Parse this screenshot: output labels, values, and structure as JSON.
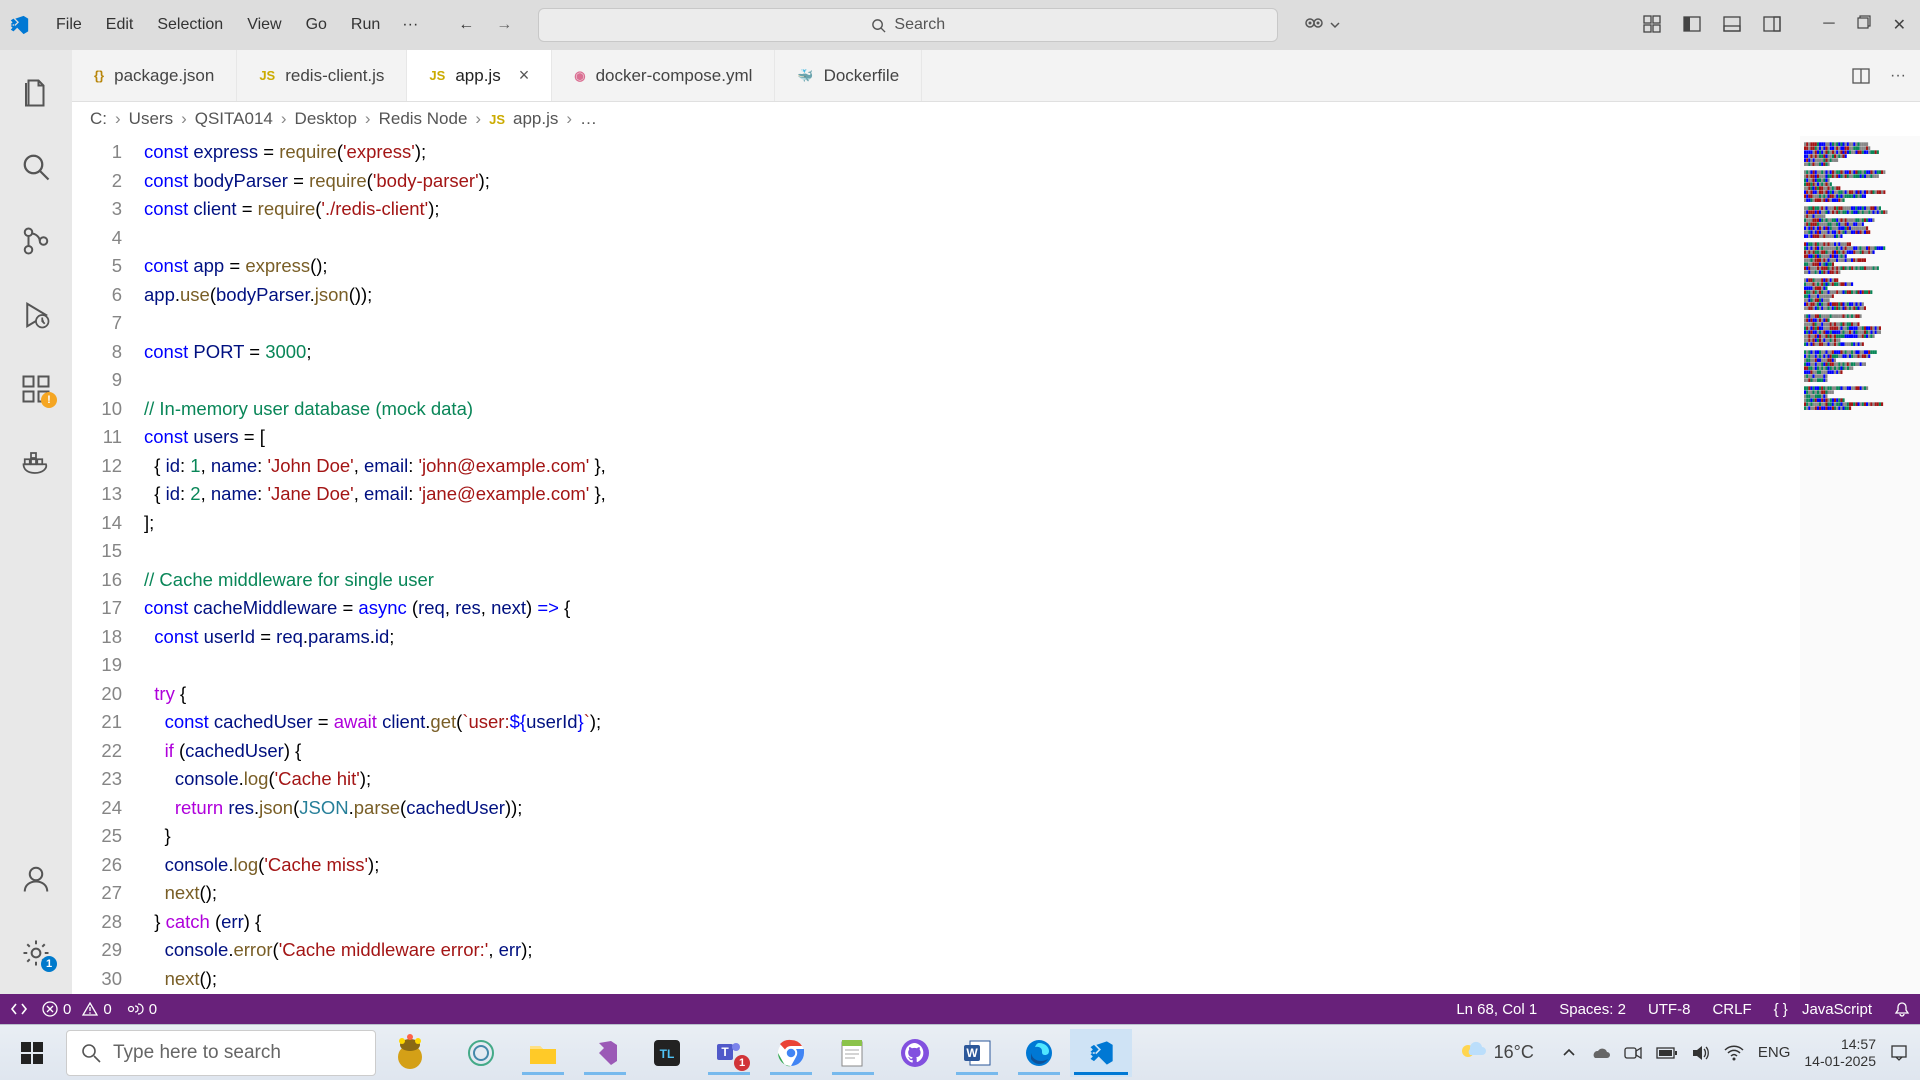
{
  "menu": {
    "file": "File",
    "edit": "Edit",
    "selection": "Selection",
    "view": "View",
    "go": "Go",
    "run": "Run"
  },
  "search_placeholder": "Search",
  "tabs": [
    {
      "icon": "{}",
      "icon_color": "#b8860b",
      "name": "package.json"
    },
    {
      "icon": "JS",
      "icon_color": "#cbab00",
      "name": "redis-client.js"
    },
    {
      "icon": "JS",
      "icon_color": "#cbab00",
      "name": "app.js",
      "active": true
    },
    {
      "icon": "◉",
      "icon_color": "#db7093",
      "name": "docker-compose.yml"
    },
    {
      "icon": "🐳",
      "icon_color": "#2496ed",
      "name": "Dockerfile"
    }
  ],
  "breadcrumb": [
    "C:",
    "Users",
    "QSITA014",
    "Desktop",
    "Redis Node",
    "app.js",
    "…"
  ],
  "code_lines": [
    [
      {
        "t": "const ",
        "c": "kw-blue"
      },
      {
        "t": "express",
        "c": "kw-var"
      },
      {
        "t": " = "
      },
      {
        "t": "require",
        "c": "kw-func"
      },
      {
        "t": "("
      },
      {
        "t": "'express'",
        "c": "kw-red"
      },
      {
        "t": ");"
      }
    ],
    [
      {
        "t": "const ",
        "c": "kw-blue"
      },
      {
        "t": "bodyParser",
        "c": "kw-var"
      },
      {
        "t": " = "
      },
      {
        "t": "require",
        "c": "kw-func"
      },
      {
        "t": "("
      },
      {
        "t": "'body-parser'",
        "c": "kw-red"
      },
      {
        "t": ");"
      }
    ],
    [
      {
        "t": "const ",
        "c": "kw-blue"
      },
      {
        "t": "client",
        "c": "kw-var"
      },
      {
        "t": " = "
      },
      {
        "t": "require",
        "c": "kw-func"
      },
      {
        "t": "("
      },
      {
        "t": "'./redis-client'",
        "c": "kw-red"
      },
      {
        "t": ");"
      }
    ],
    [
      {
        "t": ""
      }
    ],
    [
      {
        "t": "const ",
        "c": "kw-blue"
      },
      {
        "t": "app",
        "c": "kw-var"
      },
      {
        "t": " = "
      },
      {
        "t": "express",
        "c": "kw-func"
      },
      {
        "t": "();"
      }
    ],
    [
      {
        "t": "app",
        "c": "kw-var"
      },
      {
        "t": "."
      },
      {
        "t": "use",
        "c": "kw-func"
      },
      {
        "t": "("
      },
      {
        "t": "bodyParser",
        "c": "kw-var"
      },
      {
        "t": "."
      },
      {
        "t": "json",
        "c": "kw-func"
      },
      {
        "t": "());"
      }
    ],
    [
      {
        "t": ""
      }
    ],
    [
      {
        "t": "const ",
        "c": "kw-blue"
      },
      {
        "t": "PORT",
        "c": "kw-var"
      },
      {
        "t": " = "
      },
      {
        "t": "3000",
        "c": "kw-green"
      },
      {
        "t": ";"
      }
    ],
    [
      {
        "t": ""
      }
    ],
    [
      {
        "t": "// In-memory user database (mock data)",
        "c": "kw-comment"
      }
    ],
    [
      {
        "t": "const ",
        "c": "kw-blue"
      },
      {
        "t": "users",
        "c": "kw-var"
      },
      {
        "t": " = ["
      }
    ],
    [
      {
        "t": "  { "
      },
      {
        "t": "id",
        "c": "kw-var"
      },
      {
        "t": ": "
      },
      {
        "t": "1",
        "c": "kw-green"
      },
      {
        "t": ", "
      },
      {
        "t": "name",
        "c": "kw-var"
      },
      {
        "t": ": "
      },
      {
        "t": "'John Doe'",
        "c": "kw-red"
      },
      {
        "t": ", "
      },
      {
        "t": "email",
        "c": "kw-var"
      },
      {
        "t": ": "
      },
      {
        "t": "'john@example.com'",
        "c": "kw-red"
      },
      {
        "t": " },"
      }
    ],
    [
      {
        "t": "  { "
      },
      {
        "t": "id",
        "c": "kw-var"
      },
      {
        "t": ": "
      },
      {
        "t": "2",
        "c": "kw-green"
      },
      {
        "t": ", "
      },
      {
        "t": "name",
        "c": "kw-var"
      },
      {
        "t": ": "
      },
      {
        "t": "'Jane Doe'",
        "c": "kw-red"
      },
      {
        "t": ", "
      },
      {
        "t": "email",
        "c": "kw-var"
      },
      {
        "t": ": "
      },
      {
        "t": "'jane@example.com'",
        "c": "kw-red"
      },
      {
        "t": " },"
      }
    ],
    [
      {
        "t": "];"
      }
    ],
    [
      {
        "t": ""
      }
    ],
    [
      {
        "t": "// Cache middleware for single user",
        "c": "kw-comment"
      }
    ],
    [
      {
        "t": "const ",
        "c": "kw-blue"
      },
      {
        "t": "cacheMiddleware",
        "c": "kw-var"
      },
      {
        "t": " = "
      },
      {
        "t": "async",
        "c": "kw-blue"
      },
      {
        "t": " ("
      },
      {
        "t": "req",
        "c": "kw-var"
      },
      {
        "t": ", "
      },
      {
        "t": "res",
        "c": "kw-var"
      },
      {
        "t": ", "
      },
      {
        "t": "next",
        "c": "kw-var"
      },
      {
        "t": ") "
      },
      {
        "t": "=>",
        "c": "kw-blue"
      },
      {
        "t": " {"
      }
    ],
    [
      {
        "t": "  "
      },
      {
        "t": "const ",
        "c": "kw-blue"
      },
      {
        "t": "userId",
        "c": "kw-var"
      },
      {
        "t": " = "
      },
      {
        "t": "req",
        "c": "kw-var"
      },
      {
        "t": "."
      },
      {
        "t": "params",
        "c": "kw-var"
      },
      {
        "t": "."
      },
      {
        "t": "id",
        "c": "kw-var"
      },
      {
        "t": ";"
      }
    ],
    [
      {
        "t": ""
      }
    ],
    [
      {
        "t": "  "
      },
      {
        "t": "try",
        "c": "kw-purple"
      },
      {
        "t": " {"
      }
    ],
    [
      {
        "t": "    "
      },
      {
        "t": "const ",
        "c": "kw-blue"
      },
      {
        "t": "cachedUser",
        "c": "kw-var"
      },
      {
        "t": " = "
      },
      {
        "t": "await",
        "c": "kw-purple"
      },
      {
        "t": " "
      },
      {
        "t": "client",
        "c": "kw-var"
      },
      {
        "t": "."
      },
      {
        "t": "get",
        "c": "kw-func"
      },
      {
        "t": "("
      },
      {
        "t": "`user:",
        "c": "kw-red"
      },
      {
        "t": "${",
        "c": "kw-blue"
      },
      {
        "t": "userId",
        "c": "kw-var"
      },
      {
        "t": "}",
        "c": "kw-blue"
      },
      {
        "t": "`",
        "c": "kw-red"
      },
      {
        "t": ");"
      }
    ],
    [
      {
        "t": "    "
      },
      {
        "t": "if",
        "c": "kw-purple"
      },
      {
        "t": " ("
      },
      {
        "t": "cachedUser",
        "c": "kw-var"
      },
      {
        "t": ") {"
      }
    ],
    [
      {
        "t": "      "
      },
      {
        "t": "console",
        "c": "kw-var"
      },
      {
        "t": "."
      },
      {
        "t": "log",
        "c": "kw-func"
      },
      {
        "t": "("
      },
      {
        "t": "'Cache hit'",
        "c": "kw-red"
      },
      {
        "t": ");"
      }
    ],
    [
      {
        "t": "      "
      },
      {
        "t": "return",
        "c": "kw-purple"
      },
      {
        "t": " "
      },
      {
        "t": "res",
        "c": "kw-var"
      },
      {
        "t": "."
      },
      {
        "t": "json",
        "c": "kw-func"
      },
      {
        "t": "("
      },
      {
        "t": "JSON",
        "c": "kw-type"
      },
      {
        "t": "."
      },
      {
        "t": "parse",
        "c": "kw-func"
      },
      {
        "t": "("
      },
      {
        "t": "cachedUser",
        "c": "kw-var"
      },
      {
        "t": "));"
      }
    ],
    [
      {
        "t": "    }"
      }
    ],
    [
      {
        "t": "    "
      },
      {
        "t": "console",
        "c": "kw-var"
      },
      {
        "t": "."
      },
      {
        "t": "log",
        "c": "kw-func"
      },
      {
        "t": "("
      },
      {
        "t": "'Cache miss'",
        "c": "kw-red"
      },
      {
        "t": ");"
      }
    ],
    [
      {
        "t": "    "
      },
      {
        "t": "next",
        "c": "kw-func"
      },
      {
        "t": "();"
      }
    ],
    [
      {
        "t": "  } "
      },
      {
        "t": "catch",
        "c": "kw-purple"
      },
      {
        "t": " ("
      },
      {
        "t": "err",
        "c": "kw-var"
      },
      {
        "t": ") {"
      }
    ],
    [
      {
        "t": "    "
      },
      {
        "t": "console",
        "c": "kw-var"
      },
      {
        "t": "."
      },
      {
        "t": "error",
        "c": "kw-func"
      },
      {
        "t": "("
      },
      {
        "t": "'Cache middleware error:'",
        "c": "kw-red"
      },
      {
        "t": ", "
      },
      {
        "t": "err",
        "c": "kw-var"
      },
      {
        "t": ");"
      }
    ],
    [
      {
        "t": "    "
      },
      {
        "t": "next",
        "c": "kw-func"
      },
      {
        "t": "();"
      }
    ]
  ],
  "status": {
    "errors": "0",
    "warnings": "0",
    "ports": "0",
    "cursor": "Ln 68, Col 1",
    "spaces": "Spaces: 2",
    "encoding": "UTF-8",
    "eol": "CRLF",
    "lang_icon": "{ }",
    "lang": "JavaScript"
  },
  "taskbar": {
    "search_placeholder": "Type here to search",
    "weather_temp": "16°C",
    "lang": "ENG",
    "time": "14:57",
    "date": "14-01-2025"
  },
  "activitybar_badges": {
    "extensions": "!",
    "settings": "1"
  }
}
